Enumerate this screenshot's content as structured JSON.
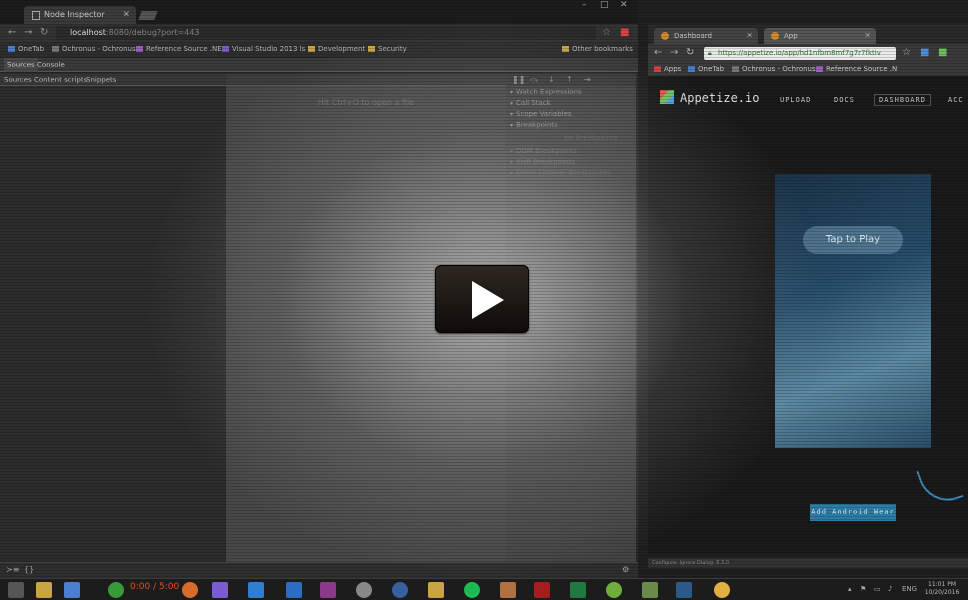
{
  "left_window": {
    "tab_title": "Node Inspector",
    "url_host": "localhost",
    "url_rest": ":8080/debug?port=443",
    "bookmarks": [
      "OneTab",
      "Ochronus - Ochronus",
      "Reference Source .NE",
      "Visual Studio 2013 ls",
      "Development",
      "Security",
      "Other bookmarks"
    ],
    "devtools_tabs": [
      "Sources",
      "Console"
    ],
    "navigator_tabs": [
      "Sources",
      "Content scripts",
      "Snippets"
    ],
    "editor_hint": "Hit Ctrl+O to open a file",
    "debugger_sections": [
      "Watch Expressions",
      "Call Stack",
      "Scope Variables",
      "Breakpoints",
      "DOM Breakpoints",
      "XHR Breakpoints",
      "Event Listener Breakpoints"
    ],
    "no_breakpoints": "No Breakpoints"
  },
  "right_window": {
    "tabs": [
      "Dashboard",
      "App"
    ],
    "url": "https://appetize.io/app/hd1nfbm8mf7g7r7fktiv",
    "bookmarks": [
      "Apps",
      "OneTab",
      "Ochronus - Ochronus",
      "Reference Source .N"
    ],
    "brand": "Appetize.io",
    "nav": [
      "UPLOAD",
      "DOCS",
      "DASHBOARD",
      "ACC"
    ],
    "tap_to_play": "Tap to Play",
    "add_wear": "Add Android Wear",
    "status": "Configure: Ignore Dialog: 8.3.0"
  },
  "video": {
    "time": "0:00 / 5:00"
  },
  "taskbar": {
    "time": "11:01 PM",
    "date": "10/20/2016",
    "lang": "ENG"
  }
}
